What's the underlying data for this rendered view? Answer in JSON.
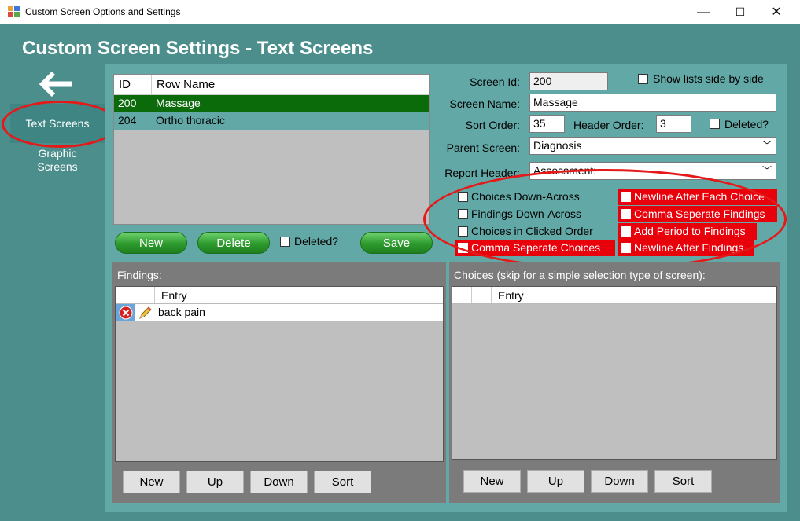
{
  "window": {
    "title": "Custom Screen Options and Settings",
    "minimize": "—",
    "maximize": "☐",
    "close": "✕"
  },
  "heading": "Custom Screen Settings - Text Screens",
  "nav": {
    "back_icon": "left-arrow-icon",
    "text_screens": "Text Screens",
    "graphic_screens_line1": "Graphic",
    "graphic_screens_line2": "Screens"
  },
  "screens_grid": {
    "headers": [
      "ID",
      "Row Name"
    ],
    "rows": [
      {
        "id": "200",
        "name": "Massage"
      },
      {
        "id": "204",
        "name": "Ortho thoracic"
      }
    ]
  },
  "grid_buttons": {
    "new": "New",
    "delete": "Delete",
    "deleted_label": "Deleted?",
    "save": "Save"
  },
  "form": {
    "screen_id_label": "Screen Id:",
    "screen_id": "200",
    "show_lists_label": "Show lists side by side",
    "screen_name_label": "Screen Name:",
    "screen_name": "Massage",
    "sort_order_label": "Sort Order:",
    "sort_order": "35",
    "header_order_label": "Header Order:",
    "header_order": "3",
    "deleted_label": "Deleted?",
    "parent_screen_label": "Parent Screen:",
    "parent_screen": "Diagnosis",
    "report_header_label": "Report Header:",
    "report_header": "Assessment:"
  },
  "options": {
    "left": [
      {
        "label": "Choices Down-Across",
        "checked": false
      },
      {
        "label": "Findings Down-Across",
        "checked": false
      },
      {
        "label": "Choices in Clicked Order",
        "checked": false
      },
      {
        "label": "Comma Seperate Choices",
        "checked": true
      }
    ],
    "right": [
      {
        "label": "Newline After Each Choice",
        "checked": true
      },
      {
        "label": "Comma Seperate Findings",
        "checked": true
      },
      {
        "label": "Add Period to Findings",
        "checked": true
      },
      {
        "label": "Newline After Findings",
        "checked": true
      }
    ]
  },
  "findings": {
    "title": "Findings:",
    "column": "Entry",
    "rows": [
      {
        "entry": "back pain",
        "delete_icon": "delete-x-icon",
        "edit_icon": "pencil-icon"
      }
    ],
    "buttons": {
      "new": "New",
      "up": "Up",
      "down": "Down",
      "sort": "Sort"
    }
  },
  "choices": {
    "title": "Choices (skip for a simple selection type of screen):",
    "column": "Entry",
    "buttons": {
      "new": "New",
      "up": "Up",
      "down": "Down",
      "sort": "Sort"
    }
  },
  "colors": {
    "background": "#4b8e8c",
    "content": "#62a8a6",
    "selected_row": "#0b6b0b",
    "highlight_red": "#e8000b",
    "annotation_red": "#e41a1a"
  }
}
